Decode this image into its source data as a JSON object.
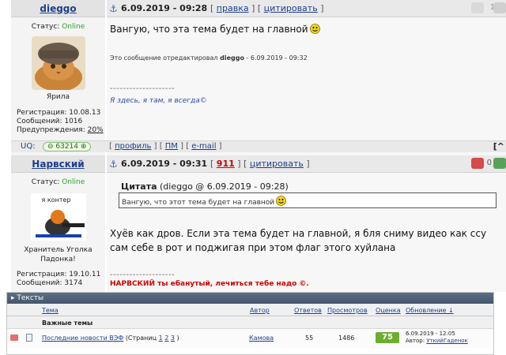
{
  "posts": [
    {
      "author": "dieggo",
      "status_label": "Статус:",
      "status_value": "Online",
      "avatar_caption": "Ярила",
      "reg_label": "Регистрация:",
      "reg_value": "10.08.13",
      "msgs_label": "Сообщений:",
      "msgs_value": "1016",
      "warn_label": "Предупреждения:",
      "warn_value": "20%",
      "date": "6.09.2019 - 09:28",
      "action1": "правка",
      "action2": "цитировать",
      "text": "Вангую, что эта тема будет на главной",
      "edit_prefix": "Это сообщение отредактировал",
      "edit_user": "dieggo",
      "edit_date": "- 6.09.2019 - 09:32",
      "sig_line": "--------------------",
      "signature": "Я здесь, я там, я всегда©",
      "uq_label": "UQ:",
      "uq_value": "63214",
      "footer_profile": "профиль",
      "footer_pm": "ПМ",
      "footer_email": "e-mail",
      "right_count": "1"
    },
    {
      "author": "Нарвский",
      "status_label": "Статус:",
      "status_value": "Online",
      "avatar_text": "я контер",
      "avatar_caption": "Хранитель Уголка Падонка!",
      "reg_label": "Регистрация:",
      "reg_value": "19.10.11",
      "msgs_label": "Сообщений:",
      "msgs_value": "3174",
      "date": "6.09.2019 - 09:31",
      "action1": "911",
      "action2": "цитировать",
      "quote_label": "Цитата",
      "quote_meta": "(dieggo @ 6.09.2019 - 09:28)",
      "quote_text": "Вангую, что этот тема будет на главной",
      "text": "Хуёв как дров. Если эта тема будет на главной, я бля сниму видео как ссу сам себе в рот и поджигая при этом флаг этого хуйлана",
      "sig_line": "--------------------",
      "signature": "НАРВСКИЙ ты ебанутый, лечиться тебе надо ©.",
      "right_count": "0"
    }
  ],
  "forum": {
    "title": "Тексты",
    "col_topic": "Тема",
    "col_author": "Автор",
    "col_replies": "Ответов",
    "col_views": "Просмотров",
    "col_rating": "Оценка",
    "col_updated": "Обновление ↓",
    "section": "Важные темы",
    "row": {
      "title": "Последние новости ВЭФ",
      "pages_prefix": "(Страниц",
      "p1": "1",
      "p2": "2",
      "p3": "3",
      "pages_suffix": ")",
      "author": "Камова",
      "replies": "55",
      "views": "1486",
      "rating": "75",
      "updated": "6.09.2019 - 12:05",
      "last_prefix": "Автор:",
      "last_author": "УткийГаденок"
    }
  },
  "colors": {
    "online": "#2aa52a",
    "link": "#1f3f8a",
    "rating": "#6cae2e",
    "sig1": "#2f47a8",
    "sig2": "#d00000"
  }
}
